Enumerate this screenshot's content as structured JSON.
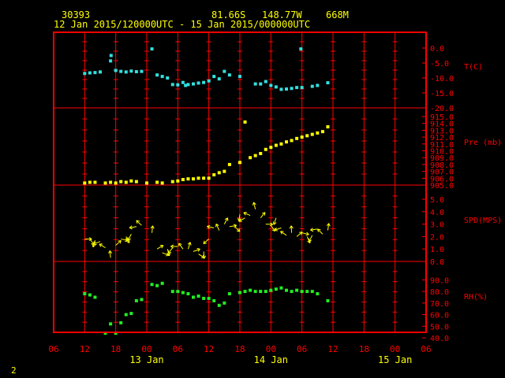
{
  "header": {
    "station": "30393",
    "lat": "81.66S",
    "lon": "148.77W",
    "elev": "668M",
    "period": "12 Jan 2015/120000UTC - 15 Jan 2015/000000UTC"
  },
  "footer": {
    "page": "2"
  },
  "colors": {
    "background": "#000000",
    "frame": "#ff0000",
    "grid": "#ff0000",
    "header_text": "#ffff00",
    "axis_text": "#ff0000",
    "day_text": "#ffff00",
    "temp": "#33e0e0",
    "pressure": "#ffff00",
    "wind": "#ffff00",
    "rh": "#22ee22"
  },
  "chart_data": {
    "type": "scatter",
    "x_axis": {
      "start_hour": 6,
      "end_hour": 78,
      "tick_step": 6,
      "tick_labels": [
        "06",
        "12",
        "18",
        "00",
        "06",
        "12",
        "18",
        "00",
        "06",
        "12",
        "18",
        "00",
        "06"
      ],
      "day_labels": [
        {
          "hour": 24,
          "text": "13 Jan"
        },
        {
          "hour": 48,
          "text": "14 Jan"
        },
        {
          "hour": 72,
          "text": "15 Jan"
        }
      ]
    },
    "panels": [
      {
        "name": "T(C)",
        "ylim": [
          -20,
          0
        ],
        "ticks": [
          "0.0",
          "-5.0",
          "-10.0",
          "-15.0",
          "-20.0"
        ],
        "tick_values": [
          0,
          -5,
          -10,
          -15,
          -20
        ],
        "mark": "square",
        "x": [
          12,
          13,
          14,
          15,
          17,
          17.1,
          18,
          19,
          20,
          21,
          22,
          23,
          25,
          26,
          27,
          28,
          29,
          30,
          31,
          31.5,
          32,
          33,
          34,
          35,
          36,
          37,
          38,
          39,
          40,
          42,
          45,
          46,
          47,
          48,
          49,
          50,
          51,
          52,
          53,
          54,
          56,
          57,
          59
        ],
        "y": [
          -8.5,
          -8.3,
          -8.2,
          -8.0,
          -4.3,
          -2.5,
          -7.5,
          -7.8,
          -8.0,
          -7.7,
          -7.9,
          -7.8,
          -0.3,
          -9.0,
          -9.5,
          -10.0,
          -12.2,
          -12.3,
          -11.5,
          -12.5,
          -12.2,
          -12.0,
          -11.7,
          -11.5,
          -11.0,
          -9.5,
          -10.3,
          -7.8,
          -9.0,
          -9.5,
          -12.0,
          -12.0,
          -11.2,
          -12.5,
          -13.0,
          -13.8,
          -13.7,
          -13.5,
          -13.2,
          -13.2,
          -12.8,
          -12.5,
          -11.6
        ],
        "extra": {
          "x": [
            53.8
          ],
          "y": [
            -0.3
          ]
        }
      },
      {
        "name": "Pre (mb)",
        "ylim": [
          905,
          915
        ],
        "ticks": [
          "915.0",
          "914.0",
          "913.0",
          "912.0",
          "911.0",
          "910.0",
          "909.0",
          "908.0",
          "907.0",
          "906.0",
          "905.0"
        ],
        "tick_values": [
          915,
          914,
          913,
          912,
          911,
          910,
          909,
          908,
          907,
          906,
          905
        ],
        "mark": "square",
        "x": [
          12,
          13,
          14,
          16,
          17,
          18,
          19,
          20,
          21,
          22,
          24,
          26,
          27,
          29,
          30,
          31,
          32,
          33,
          34,
          35,
          36,
          37,
          38,
          39,
          40,
          42,
          43,
          44,
          45,
          46,
          47,
          48,
          49,
          50,
          51,
          52,
          53,
          54,
          55,
          56,
          57,
          58,
          59
        ],
        "y": [
          905.3,
          905.4,
          905.4,
          905.3,
          905.4,
          905.3,
          905.5,
          905.4,
          905.6,
          905.5,
          905.3,
          905.4,
          905.3,
          905.5,
          905.6,
          905.8,
          905.9,
          905.9,
          906.0,
          906.0,
          906.0,
          906.5,
          906.8,
          907.0,
          908.0,
          908.3,
          914.2,
          909.0,
          909.3,
          909.6,
          910.2,
          910.5,
          910.8,
          911.0,
          911.3,
          911.5,
          911.8,
          912.0,
          912.2,
          912.4,
          912.6,
          912.8,
          913.5
        ]
      },
      {
        "name": "SPD(MPS)",
        "ylim": [
          0,
          5
        ],
        "ticks": [
          "5.0",
          "4.0",
          "3.0",
          "2.0",
          "1.0",
          "0.0"
        ],
        "tick_values": [
          5,
          4,
          3,
          2,
          1,
          0
        ],
        "mark": "arrow",
        "x": [
          12,
          13,
          14,
          15,
          16,
          17,
          18,
          19,
          20,
          21,
          22,
          23,
          25,
          26,
          27,
          28,
          29,
          30,
          31,
          32,
          33,
          34,
          35,
          36,
          37,
          38,
          39,
          40,
          41,
          42,
          43,
          44,
          45,
          46,
          47,
          48,
          49,
          50,
          51,
          52,
          53,
          54,
          55,
          56,
          57,
          58,
          59
        ],
        "y": [
          1.8,
          1.8,
          1.7,
          1.6,
          1.1,
          0.3,
          1.3,
          1.8,
          2.0,
          2.2,
          2.8,
          2.9,
          2.3,
          1.0,
          0.7,
          1.0,
          1.1,
          1.2,
          1.0,
          1.0,
          0.8,
          0.6,
          0.8,
          1.8,
          2.7,
          2.5,
          3.0,
          2.8,
          2.8,
          3.8,
          3.5,
          3.7,
          4.2,
          3.5,
          3.0,
          2.9,
          3.5,
          2.7,
          2.1,
          2.3,
          2.0,
          2.3,
          2.0,
          2.1,
          2.6,
          2.2,
          2.5
        ]
      },
      {
        "name": "RH(%)",
        "ylim": [
          40,
          95
        ],
        "ticks": [
          "90.0",
          "80.0",
          "70.0",
          "60.0",
          "50.0",
          "40.0"
        ],
        "tick_values": [
          90,
          80,
          70,
          60,
          50,
          40
        ],
        "mark": "square",
        "x": [
          12,
          13,
          14,
          16,
          17,
          18,
          19,
          20,
          21,
          22,
          23,
          25,
          26,
          27,
          29,
          30,
          31,
          32,
          33,
          34,
          35,
          36,
          37,
          38,
          39,
          40,
          42,
          43,
          44,
          45,
          46,
          47,
          48,
          49,
          50,
          51,
          52,
          53,
          54,
          55,
          56,
          57,
          59
        ],
        "y": [
          78,
          77,
          75,
          44,
          52,
          44,
          53,
          60,
          61,
          72,
          73,
          86,
          85,
          87,
          80,
          80,
          79,
          78,
          75,
          76,
          74,
          74,
          72,
          68,
          70,
          78,
          79,
          80,
          81,
          80,
          80,
          80,
          81,
          82,
          83,
          81,
          80,
          81,
          80,
          80,
          80,
          78,
          72
        ]
      }
    ]
  }
}
